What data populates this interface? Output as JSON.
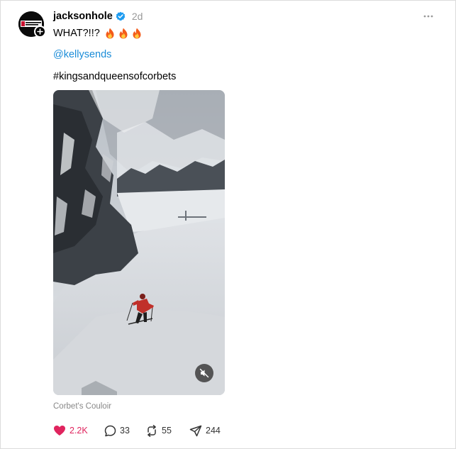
{
  "post": {
    "username": "jacksonhole",
    "timestamp": "2d",
    "text_line1": "WHAT?!!?",
    "mention": "@kellysends",
    "hashtag": "#kingsandqueensofcorbets",
    "location": "Corbet's Couloir",
    "avatar_text": "JACKSON HOLE"
  },
  "actions": {
    "likes": "2.2K",
    "replies": "33",
    "reposts": "55",
    "shares": "244"
  },
  "colors": {
    "like": "#e0245e",
    "mention": "#1a8cd8",
    "verified": "#1d9bf0",
    "flame": "#f35b1a"
  },
  "icons": [
    "verified-icon",
    "follow-plus-icon",
    "more-options-icon",
    "fire-icon",
    "mute-icon",
    "heart-icon",
    "comment-icon",
    "repost-icon",
    "share-icon"
  ]
}
